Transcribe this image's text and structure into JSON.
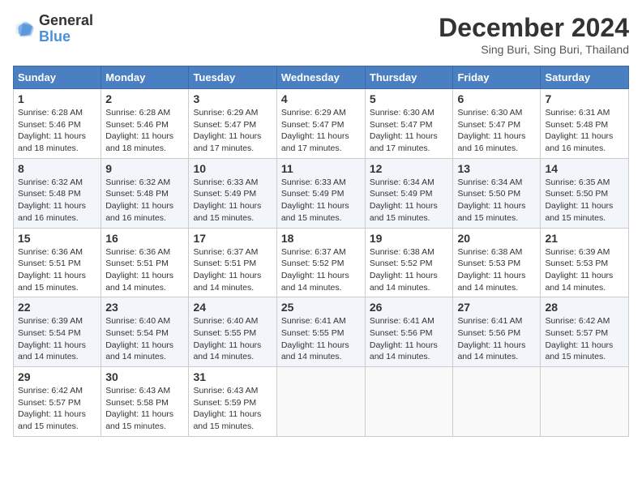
{
  "header": {
    "logo_general": "General",
    "logo_blue": "Blue",
    "month_title": "December 2024",
    "location": "Sing Buri, Sing Buri, Thailand"
  },
  "calendar": {
    "headers": [
      "Sunday",
      "Monday",
      "Tuesday",
      "Wednesday",
      "Thursday",
      "Friday",
      "Saturday"
    ],
    "weeks": [
      [
        null,
        null,
        null,
        null,
        null,
        null,
        null
      ]
    ],
    "days": {
      "1": {
        "sunrise": "6:28 AM",
        "sunset": "5:46 PM",
        "daylight": "11 hours and 18 minutes."
      },
      "2": {
        "sunrise": "6:28 AM",
        "sunset": "5:46 PM",
        "daylight": "11 hours and 18 minutes."
      },
      "3": {
        "sunrise": "6:29 AM",
        "sunset": "5:47 PM",
        "daylight": "11 hours and 17 minutes."
      },
      "4": {
        "sunrise": "6:29 AM",
        "sunset": "5:47 PM",
        "daylight": "11 hours and 17 minutes."
      },
      "5": {
        "sunrise": "6:30 AM",
        "sunset": "5:47 PM",
        "daylight": "11 hours and 17 minutes."
      },
      "6": {
        "sunrise": "6:30 AM",
        "sunset": "5:47 PM",
        "daylight": "11 hours and 16 minutes."
      },
      "7": {
        "sunrise": "6:31 AM",
        "sunset": "5:48 PM",
        "daylight": "11 hours and 16 minutes."
      },
      "8": {
        "sunrise": "6:32 AM",
        "sunset": "5:48 PM",
        "daylight": "11 hours and 16 minutes."
      },
      "9": {
        "sunrise": "6:32 AM",
        "sunset": "5:48 PM",
        "daylight": "11 hours and 16 minutes."
      },
      "10": {
        "sunrise": "6:33 AM",
        "sunset": "5:49 PM",
        "daylight": "11 hours and 15 minutes."
      },
      "11": {
        "sunrise": "6:33 AM",
        "sunset": "5:49 PM",
        "daylight": "11 hours and 15 minutes."
      },
      "12": {
        "sunrise": "6:34 AM",
        "sunset": "5:49 PM",
        "daylight": "11 hours and 15 minutes."
      },
      "13": {
        "sunrise": "6:34 AM",
        "sunset": "5:50 PM",
        "daylight": "11 hours and 15 minutes."
      },
      "14": {
        "sunrise": "6:35 AM",
        "sunset": "5:50 PM",
        "daylight": "11 hours and 15 minutes."
      },
      "15": {
        "sunrise": "6:36 AM",
        "sunset": "5:51 PM",
        "daylight": "11 hours and 15 minutes."
      },
      "16": {
        "sunrise": "6:36 AM",
        "sunset": "5:51 PM",
        "daylight": "11 hours and 14 minutes."
      },
      "17": {
        "sunrise": "6:37 AM",
        "sunset": "5:51 PM",
        "daylight": "11 hours and 14 minutes."
      },
      "18": {
        "sunrise": "6:37 AM",
        "sunset": "5:52 PM",
        "daylight": "11 hours and 14 minutes."
      },
      "19": {
        "sunrise": "6:38 AM",
        "sunset": "5:52 PM",
        "daylight": "11 hours and 14 minutes."
      },
      "20": {
        "sunrise": "6:38 AM",
        "sunset": "5:53 PM",
        "daylight": "11 hours and 14 minutes."
      },
      "21": {
        "sunrise": "6:39 AM",
        "sunset": "5:53 PM",
        "daylight": "11 hours and 14 minutes."
      },
      "22": {
        "sunrise": "6:39 AM",
        "sunset": "5:54 PM",
        "daylight": "11 hours and 14 minutes."
      },
      "23": {
        "sunrise": "6:40 AM",
        "sunset": "5:54 PM",
        "daylight": "11 hours and 14 minutes."
      },
      "24": {
        "sunrise": "6:40 AM",
        "sunset": "5:55 PM",
        "daylight": "11 hours and 14 minutes."
      },
      "25": {
        "sunrise": "6:41 AM",
        "sunset": "5:55 PM",
        "daylight": "11 hours and 14 minutes."
      },
      "26": {
        "sunrise": "6:41 AM",
        "sunset": "5:56 PM",
        "daylight": "11 hours and 14 minutes."
      },
      "27": {
        "sunrise": "6:41 AM",
        "sunset": "5:56 PM",
        "daylight": "11 hours and 14 minutes."
      },
      "28": {
        "sunrise": "6:42 AM",
        "sunset": "5:57 PM",
        "daylight": "11 hours and 15 minutes."
      },
      "29": {
        "sunrise": "6:42 AM",
        "sunset": "5:57 PM",
        "daylight": "11 hours and 15 minutes."
      },
      "30": {
        "sunrise": "6:43 AM",
        "sunset": "5:58 PM",
        "daylight": "11 hours and 15 minutes."
      },
      "31": {
        "sunrise": "6:43 AM",
        "sunset": "5:59 PM",
        "daylight": "11 hours and 15 minutes."
      }
    }
  }
}
